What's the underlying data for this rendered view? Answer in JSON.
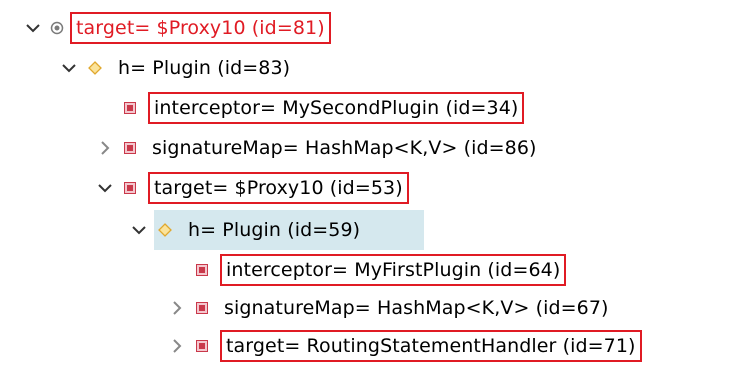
{
  "tree": {
    "rows": [
      {
        "label": "target= $Proxy10  (id=81)",
        "expander": "expanded",
        "icon": "root-object-icon",
        "boxed": true,
        "selected": false
      },
      {
        "label": "h= Plugin  (id=83)",
        "expander": "expanded",
        "icon": "diamond-icon",
        "boxed": false,
        "selected": false
      },
      {
        "label": "interceptor= MySecondPlugin  (id=34)",
        "expander": "none",
        "icon": "private-field-icon",
        "boxed": true,
        "selected": false
      },
      {
        "label": "signatureMap= HashMap<K,V>  (id=86)",
        "expander": "collapsed",
        "icon": "private-field-icon",
        "boxed": false,
        "selected": false
      },
      {
        "label": "target= $Proxy10  (id=53)",
        "expander": "expanded",
        "icon": "private-field-icon",
        "boxed": true,
        "selected": false
      },
      {
        "label": "h= Plugin  (id=59)",
        "expander": "expanded",
        "icon": "diamond-icon",
        "boxed": false,
        "selected": true
      },
      {
        "label": "interceptor= MyFirstPlugin  (id=64)",
        "expander": "none",
        "icon": "private-field-icon",
        "boxed": true,
        "selected": false
      },
      {
        "label": "signatureMap= HashMap<K,V>  (id=67)",
        "expander": "collapsed",
        "icon": "private-field-icon",
        "boxed": false,
        "selected": false
      },
      {
        "label": "target= RoutingStatementHandler  (id=71)",
        "expander": "collapsed",
        "icon": "private-field-icon",
        "boxed": true,
        "selected": false
      }
    ]
  },
  "colors": {
    "highlight_border": "#e01b24",
    "field_icon": "#c9384a",
    "diamond_icon": "#e8b64b",
    "selection": "#d5e8ee",
    "chevron": "#555555"
  }
}
